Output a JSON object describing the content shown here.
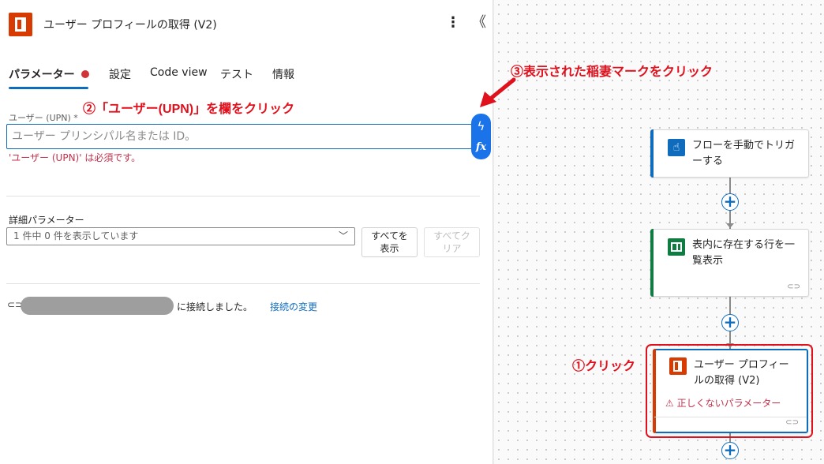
{
  "panel": {
    "title": "ユーザー プロフィールの取得 (V2)",
    "more_icon": "⋮",
    "collapse_icon": "《",
    "tabs": [
      {
        "label": "パラメーター",
        "active": true
      },
      {
        "label": "設定"
      },
      {
        "label": "Code view"
      },
      {
        "label": "テスト"
      },
      {
        "label": "情報"
      }
    ],
    "upn_field": {
      "label": "ユーザー (UPN) *",
      "placeholder": "ユーザー プリンシパル名または ID。",
      "error": "'ユーザー (UPN)' は必須です。"
    },
    "dynamic_content_icon": "ϟ",
    "expression_icon": "fx",
    "advanced": {
      "label": "詳細パラメーター",
      "select_value": "1 件中 0 件を表示しています",
      "chevron": "﹀",
      "show_all_line1": "すべてを",
      "show_all_line2": "表示",
      "clear_all_line1": "すべてク",
      "clear_all_line2": "リア"
    },
    "connection": {
      "icon": "⊂⊃",
      "status_text": "に接続しました。",
      "change_link": "接続の変更"
    }
  },
  "canvas": {
    "nodes": [
      {
        "title": "フローを手動でトリガーする",
        "icon": "☝",
        "accent": "#0f6cbd"
      },
      {
        "title": "表内に存在する行を一覧表示",
        "icon": "excel-icon",
        "accent": "#107c41"
      },
      {
        "title": "ユーザー プロフィールの取得 (V2)",
        "icon": "office-icon",
        "accent": "#d83b01",
        "warning": "⚠ 正しくないパラメーター"
      }
    ],
    "add_icon": "+",
    "link_icon": "⊂⊃"
  },
  "annotations": {
    "step1": "①クリック",
    "step2": "②「ユーザー(UPN)」を欄をクリック",
    "step3": "③表示された稲妻マークをクリック",
    "color": "#e0101c"
  }
}
